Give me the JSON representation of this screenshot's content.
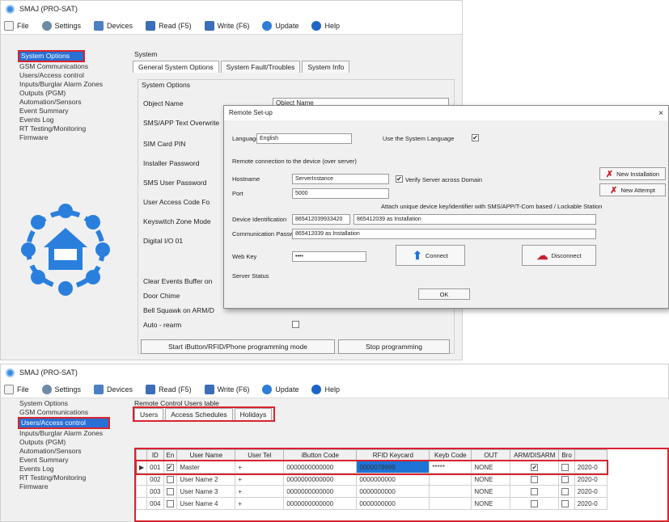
{
  "app_title": "SMAJ (PRO-SAT)",
  "menu": [
    {
      "label": "File",
      "icon": "file-icon"
    },
    {
      "label": "Settings",
      "icon": "gear-icon"
    },
    {
      "label": "Devices",
      "icon": "devices-icon"
    },
    {
      "label": "Read (F5)",
      "icon": "read-icon"
    },
    {
      "label": "Write (F6)",
      "icon": "write-icon"
    },
    {
      "label": "Update",
      "icon": "update-icon"
    },
    {
      "label": "Help",
      "icon": "help-icon"
    }
  ],
  "sidebar": [
    "System Options",
    "GSM Communications",
    "Users/Access control",
    "Inputs/Burglar Alarm Zones",
    "Outputs (PGM)",
    "Automation/Sensors",
    "Event Summary",
    "Events Log",
    "RT Testing/Monitoring",
    "Firmware"
  ],
  "top": {
    "group_title": "System",
    "tabs": [
      "General System Options",
      "System Fault/Troubles",
      "System Info"
    ],
    "subgroup": "System Options",
    "fields": [
      {
        "label": "Object Name",
        "value": "Object Name"
      },
      {
        "label": "SMS/APP Text Overwrite",
        "value": ""
      },
      {
        "label": "SIM Card PIN",
        "value": ""
      },
      {
        "label": "Installer Password",
        "value": ""
      },
      {
        "label": "SMS User Password",
        "value": ""
      },
      {
        "label": "User Access Code Fo",
        "value": ""
      },
      {
        "label": "Keyswitch Zone Mode",
        "value": ""
      },
      {
        "label": "Digital I/O 01",
        "value": ""
      },
      {
        "label": "Clear Events Buffer on",
        "value": ""
      },
      {
        "label": "Door Chime",
        "value": ""
      },
      {
        "label": "Bell Squawk on ARM/D",
        "value": ""
      },
      {
        "label": "Auto - rearm",
        "value": ""
      }
    ],
    "btn_start": "Start iButton/RFID/Phone programming mode",
    "btn_stop": "Stop programming"
  },
  "dialog": {
    "title": "Remote Set-up",
    "language_label": "Language",
    "language_value": "English",
    "use_system_lang": "Use the System Language",
    "section_label": "Remote connection to the device (over server)",
    "hostname_label": "Hostname",
    "hostname_value": "ServerInstance",
    "default_server_label": "Verify Server across Domain",
    "port_label": "Port",
    "port_value": "5000",
    "info_text": "Attach unique device key/identifier with SMS/APP/T-Com based / Lockable Station",
    "device_id_label": "Device Identification",
    "device_id_value": "865412039933420",
    "device_id_value2": "865412039 as Installation",
    "device_name_label": "Communication Password",
    "device_name_value": "865412039 as Installation",
    "app_key_label": "Web Key",
    "app_key_value": "••••",
    "connect_label": "Connect",
    "disconnect_label": "Disconnect",
    "status_label": "Server Status",
    "btn_new_device": "New Installation",
    "btn_new_attempt": "New Attempt",
    "ok_label": "OK"
  },
  "bottom": {
    "group_title": "Remote Control Users table",
    "tabs": [
      "Users",
      "Access Schedules",
      "Holidays"
    ],
    "columns": [
      "ID",
      "En",
      "User Name",
      "User Tel",
      "iButton Code",
      "RFID Keycard",
      "Keyb Code",
      "OUT",
      "ARM/DISARM",
      "Bro",
      ""
    ],
    "rows": [
      {
        "id": "001",
        "en": "✔",
        "name": "Master",
        "tel": "+",
        "ibutton": "0000000000000",
        "rfid": "0000078699",
        "keyb": "*****",
        "out": "NONE",
        "arm": "✔",
        "bro": "",
        "date": "2020-0"
      },
      {
        "id": "002",
        "en": "",
        "name": "User Name 2",
        "tel": "+",
        "ibutton": "0000000000000",
        "rfid": "0000000000",
        "keyb": "",
        "out": "NONE",
        "arm": "",
        "bro": "",
        "date": "2020-0"
      },
      {
        "id": "003",
        "en": "",
        "name": "User Name 3",
        "tel": "+",
        "ibutton": "0000000000000",
        "rfid": "0000000000",
        "keyb": "",
        "out": "NONE",
        "arm": "",
        "bro": "",
        "date": "2020-0"
      },
      {
        "id": "004",
        "en": "",
        "name": "User Name 4",
        "tel": "+",
        "ibutton": "0000000000000",
        "rfid": "0000000000",
        "keyb": "",
        "out": "NONE",
        "arm": "",
        "bro": "",
        "date": "2020-0"
      }
    ]
  },
  "colors": {
    "accent": "#2a6fd4",
    "highlight_border": "#d9232d",
    "logo_blue": "#2a7fdd"
  }
}
